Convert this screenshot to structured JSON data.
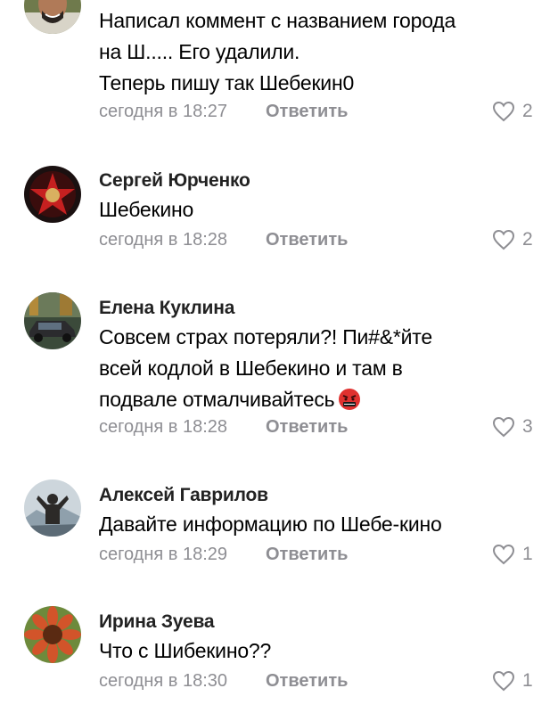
{
  "colors": {
    "meta_gray": "#8e8e93",
    "like_heart": "#8e8e93",
    "text": "#000000",
    "author": "#222222"
  },
  "comments": [
    {
      "author": "",
      "lines": [
        "Написал коммент с названием города",
        "на Ш..... Его удалили.",
        "Теперь пишу так Шебекин0"
      ],
      "time": "сегодня в 18:27",
      "reply_label": "Ответить",
      "likes": "2",
      "avatar": "man-smiling-avatar"
    },
    {
      "author": "Сергей Юрченко",
      "lines": [
        "Шебекино"
      ],
      "time": "сегодня в 18:28",
      "reply_label": "Ответить",
      "likes": "2",
      "avatar": "red-star-avatar"
    },
    {
      "author": "Елена Куклина",
      "lines": [
        "Совсем страх потеряли?! Пи#&*йте",
        "всей кодлой в Шебекино и там в",
        "подвале отмалчивайтесь"
      ],
      "emoji": "angry-face-emoji",
      "time": "сегодня в 18:28",
      "reply_label": "Ответить",
      "likes": "3",
      "avatar": "car-avatar"
    },
    {
      "author": "Алексей Гаврилов",
      "lines": [
        "Давайте информацию по Шебе-кино"
      ],
      "time": "сегодня в 18:29",
      "reply_label": "Ответить",
      "likes": "1",
      "avatar": "man-mountain-avatar"
    },
    {
      "author": "Ирина Зуева",
      "lines": [
        "Что с Шибекино??"
      ],
      "time": "сегодня в 18:30",
      "reply_label": "Ответить",
      "likes": "1",
      "avatar": "sunflower-avatar"
    }
  ]
}
